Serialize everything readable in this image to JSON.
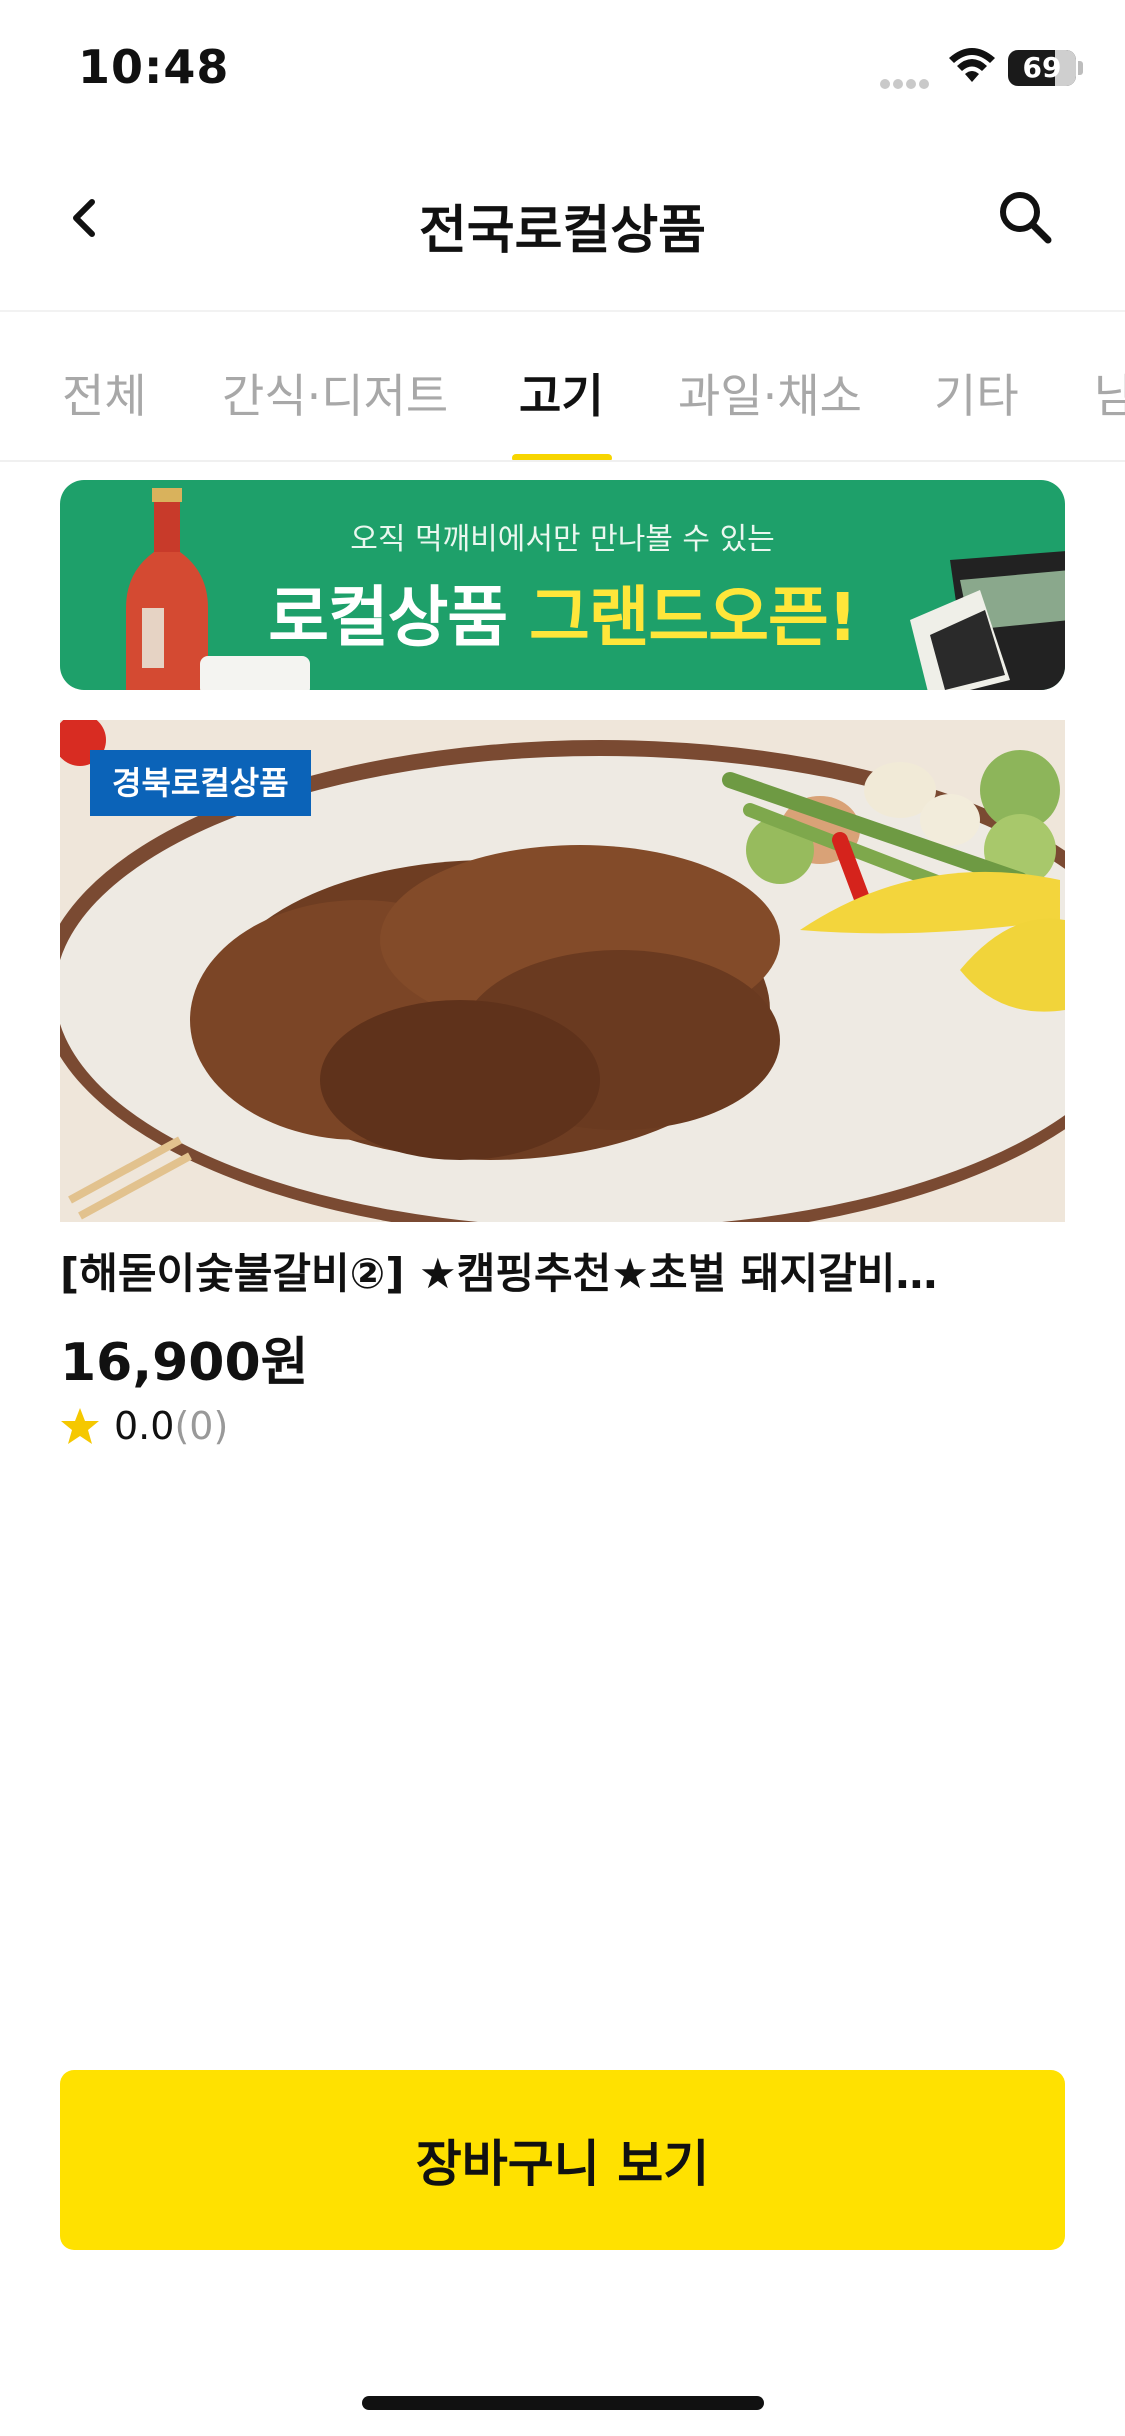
{
  "status_bar": {
    "time": "10:48",
    "battery": "69",
    "battery_level": 0.69
  },
  "header": {
    "title": "전국로컬상품",
    "back_icon": "chevron-left-icon",
    "search_icon": "search-icon"
  },
  "tabs": [
    {
      "label": "전체",
      "active": false
    },
    {
      "label": "간식·디저트",
      "active": false
    },
    {
      "label": "고기",
      "active": true
    },
    {
      "label": "과일·채소",
      "active": false
    },
    {
      "label": "기타",
      "active": false
    },
    {
      "label": "남",
      "active": false
    }
  ],
  "banner": {
    "subtitle": "오직 먹깨비에서만 만나볼 수 있는",
    "title_white": "로컬상품 ",
    "title_yellow": "그랜드오픈!"
  },
  "product": {
    "badge": "경북로컬상품",
    "name": "[해돋이숯불갈비②] ★캠핑추천★초벌 돼지갈비…",
    "price": "16,900원",
    "rating": "0.0",
    "review_count": "(0)"
  },
  "cart_button": {
    "label": "장바구니 보기"
  },
  "colors": {
    "accent_yellow": "#ffe100",
    "tab_indicator": "#f7d500",
    "banner_green": "#1ea06a",
    "badge_blue": "#0b63b8"
  }
}
